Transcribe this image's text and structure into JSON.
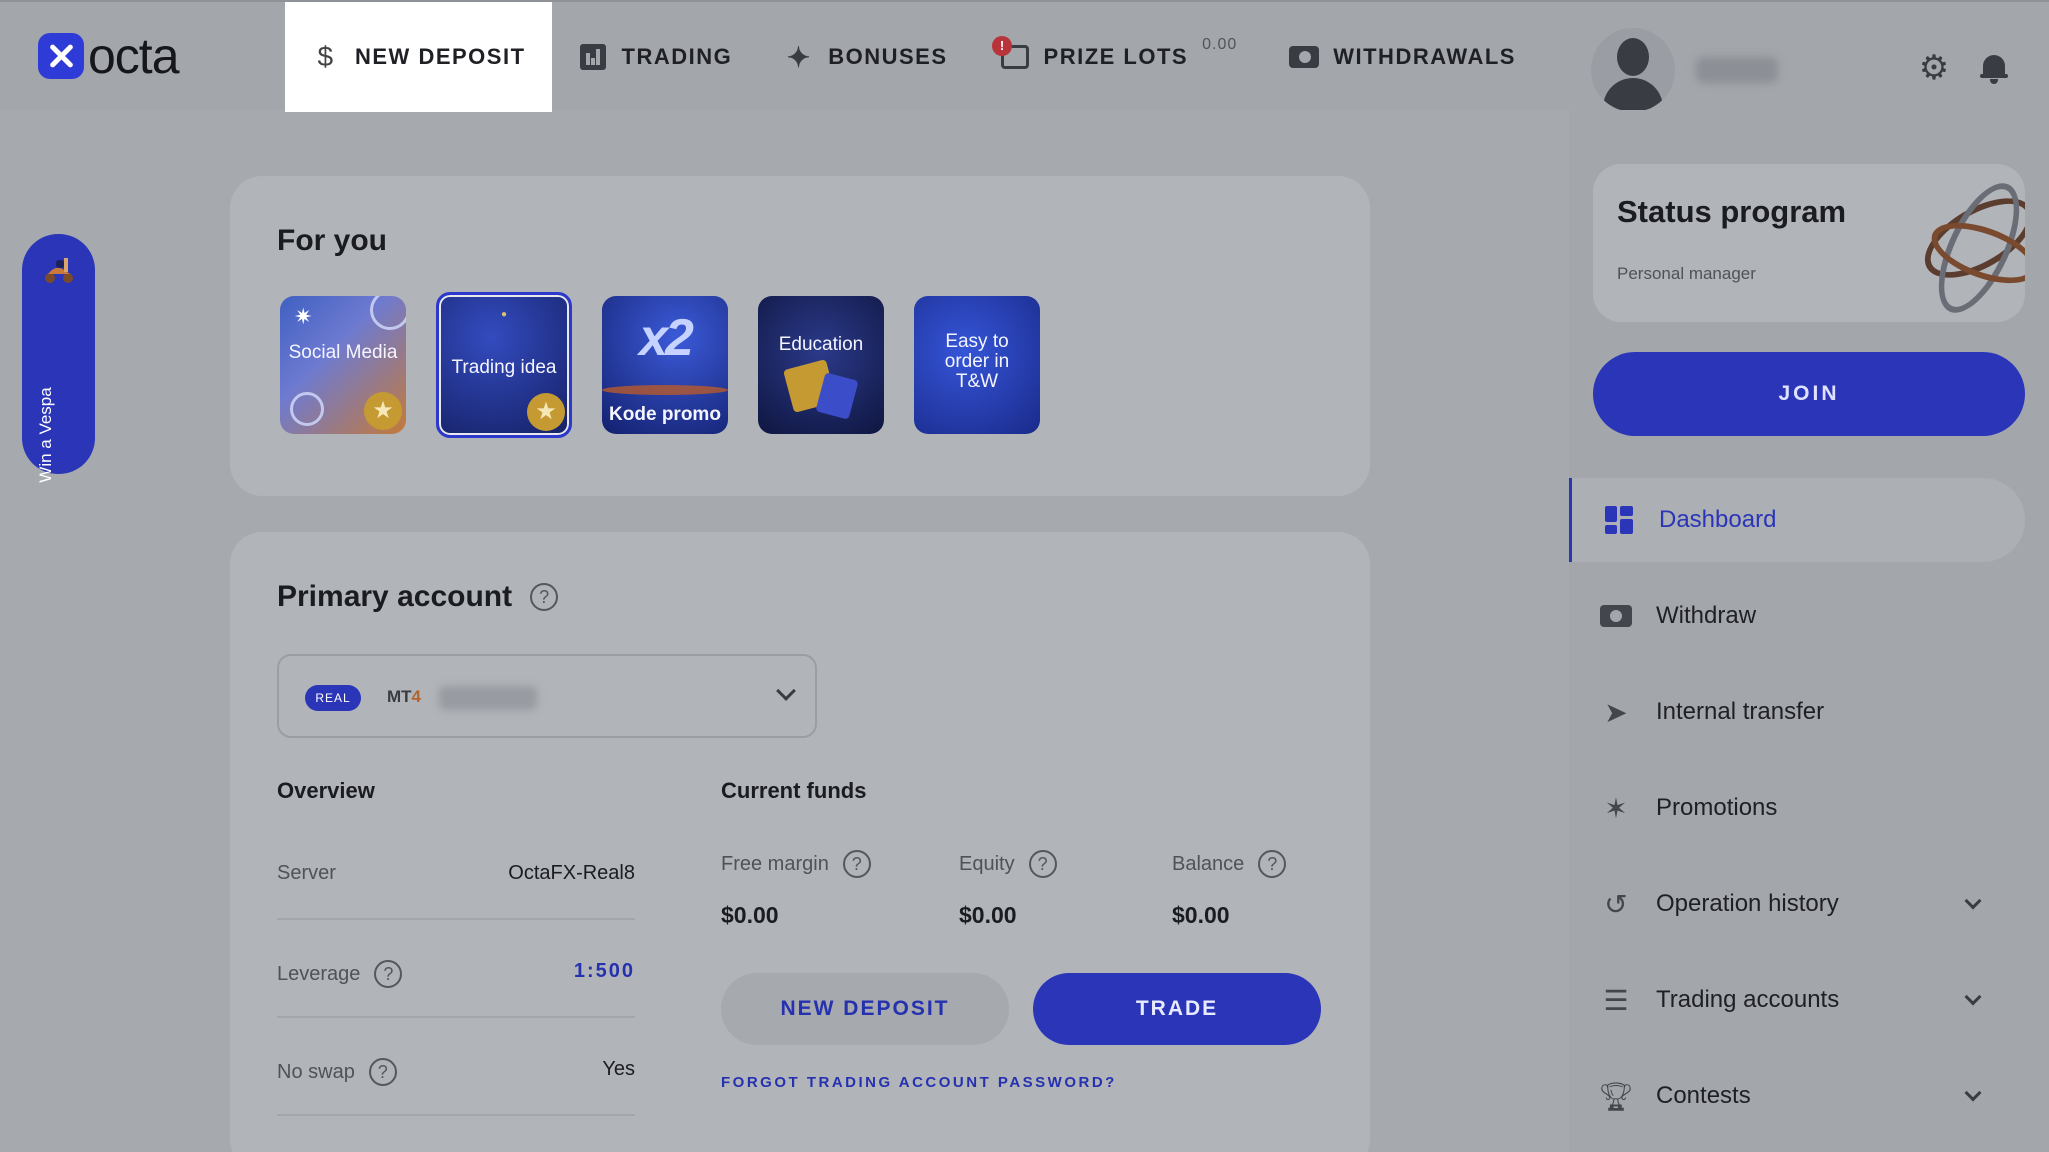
{
  "brand": {
    "name": "octa"
  },
  "nav": {
    "items": [
      {
        "label": "NEW DEPOSIT",
        "icon": "dollar-icon",
        "active": true
      },
      {
        "label": "TRADING",
        "icon": "chart-bars-icon"
      },
      {
        "label": "BONUSES",
        "icon": "sparkle-icon"
      },
      {
        "label": "PRIZE LOTS",
        "icon": "gift-icon",
        "value": "0.00",
        "badge": "!"
      },
      {
        "label": "WITHDRAWALS",
        "icon": "wallet-icon"
      }
    ]
  },
  "promo_tab": {
    "label": "Win a Vespa",
    "icon": "scooter-icon"
  },
  "for_you": {
    "title": "For you",
    "tiles": [
      {
        "label": "Social Media",
        "icon": "star-icon"
      },
      {
        "label": "Trading idea",
        "icon": "star-icon"
      },
      {
        "label": "Kode promo",
        "art": "x2"
      },
      {
        "label": "Education"
      },
      {
        "label": "Easy to order in T&W"
      }
    ]
  },
  "account": {
    "title": "Primary account",
    "badge": "REAL",
    "platform_prefix": "MT",
    "platform_suffix": "4",
    "overview": {
      "title": "Overview",
      "rows": [
        {
          "label": "Server",
          "value": "OctaFX-Real8"
        },
        {
          "label": "Leverage",
          "value": "1:500"
        },
        {
          "label": "No swap",
          "value": "Yes"
        }
      ]
    },
    "funds": {
      "title": "Current funds",
      "items": [
        {
          "label": "Free margin",
          "value": "$0.00"
        },
        {
          "label": "Equity",
          "value": "$0.00"
        },
        {
          "label": "Balance",
          "value": "$0.00"
        }
      ]
    },
    "deposit_button": "NEW DEPOSIT",
    "trade_button": "TRADE",
    "forgot_link": "FORGOT TRADING ACCOUNT PASSWORD?"
  },
  "status": {
    "title": "Status program",
    "subtitle": "Personal manager",
    "join_button": "JOIN"
  },
  "sidebar": {
    "items": [
      {
        "label": "Dashboard",
        "icon": "dashboard-icon",
        "active": true
      },
      {
        "label": "Withdraw",
        "icon": "wallet-icon"
      },
      {
        "label": "Internal transfer",
        "icon": "send-icon"
      },
      {
        "label": "Promotions",
        "icon": "party-icon"
      },
      {
        "label": "Operation history",
        "icon": "history-icon",
        "expandable": true
      },
      {
        "label": "Trading accounts",
        "icon": "list-icon",
        "expandable": true
      },
      {
        "label": "Contests",
        "icon": "trophy-icon",
        "expandable": true
      }
    ]
  },
  "colors": {
    "accent": "#2a35b8",
    "overlay": "#a3a6ab",
    "card": "#b1b4b9"
  }
}
